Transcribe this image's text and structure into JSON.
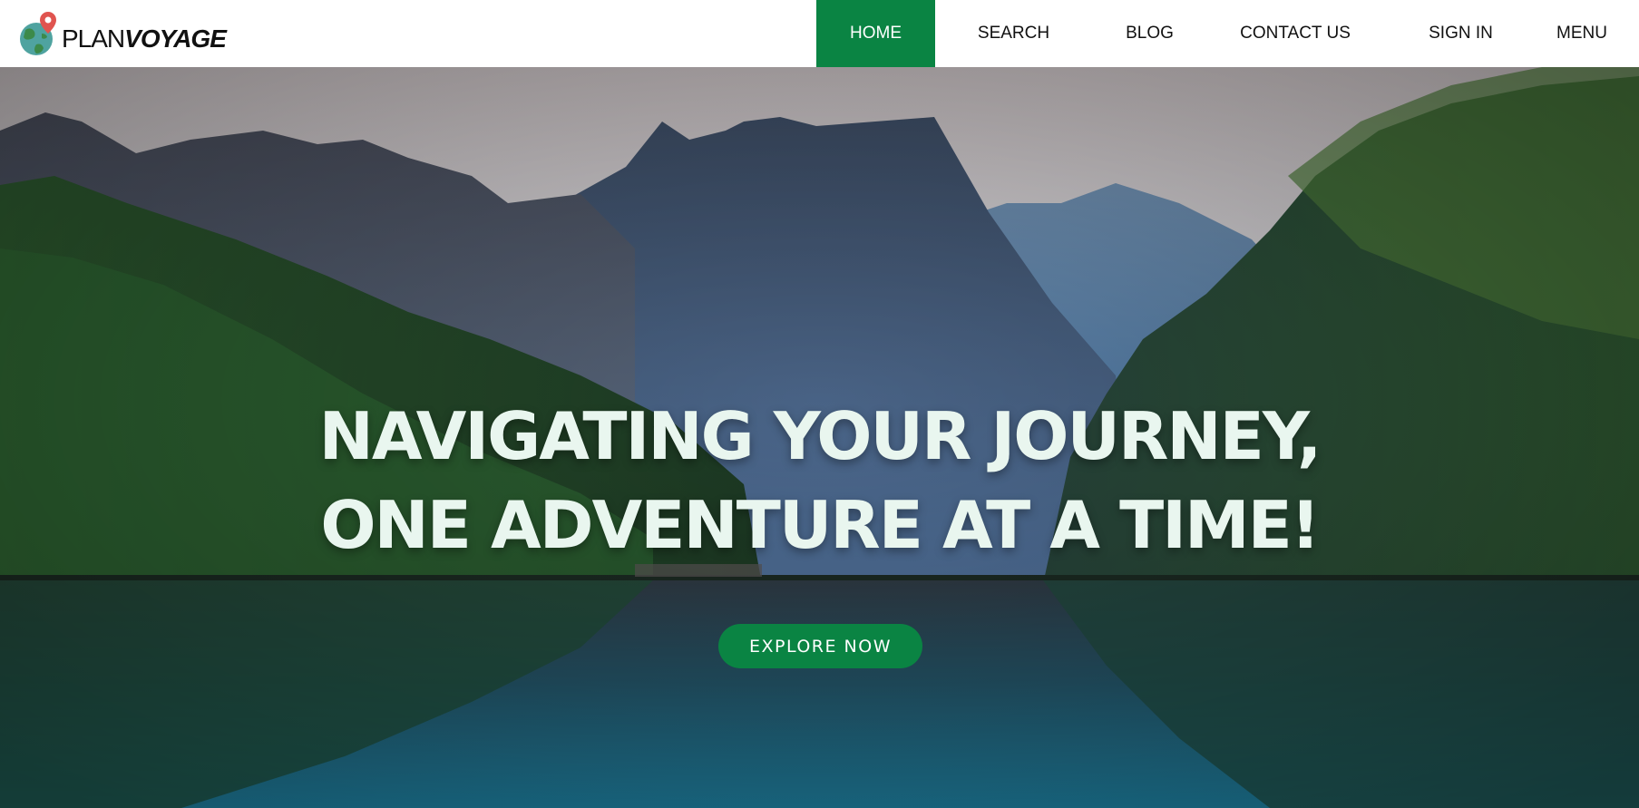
{
  "brand": {
    "name_part1": "PLAN",
    "name_part2": "VOYAGE",
    "logo_icon": "globe-with-map-pin-icon"
  },
  "nav": {
    "items": [
      {
        "label": "HOME",
        "active": true
      },
      {
        "label": "SEARCH",
        "active": false
      },
      {
        "label": "BLOG",
        "active": false
      },
      {
        "label": "CONTACT US",
        "active": false
      },
      {
        "label": "SIGN IN",
        "active": false
      },
      {
        "label": "MENU",
        "active": false
      }
    ]
  },
  "hero": {
    "headline_line1": "NAVIGATING YOUR JOURNEY,",
    "headline_line2": "ONE ADVENTURE AT A TIME!",
    "cta_label": "EXPLORE NOW",
    "background": "mountain lake with forest reflection"
  },
  "colors": {
    "accent": "#0a8443",
    "header_bg": "#ffffff",
    "nav_text": "#111111",
    "headline_text": "#e9f6ef",
    "pin": "#e0544f"
  }
}
